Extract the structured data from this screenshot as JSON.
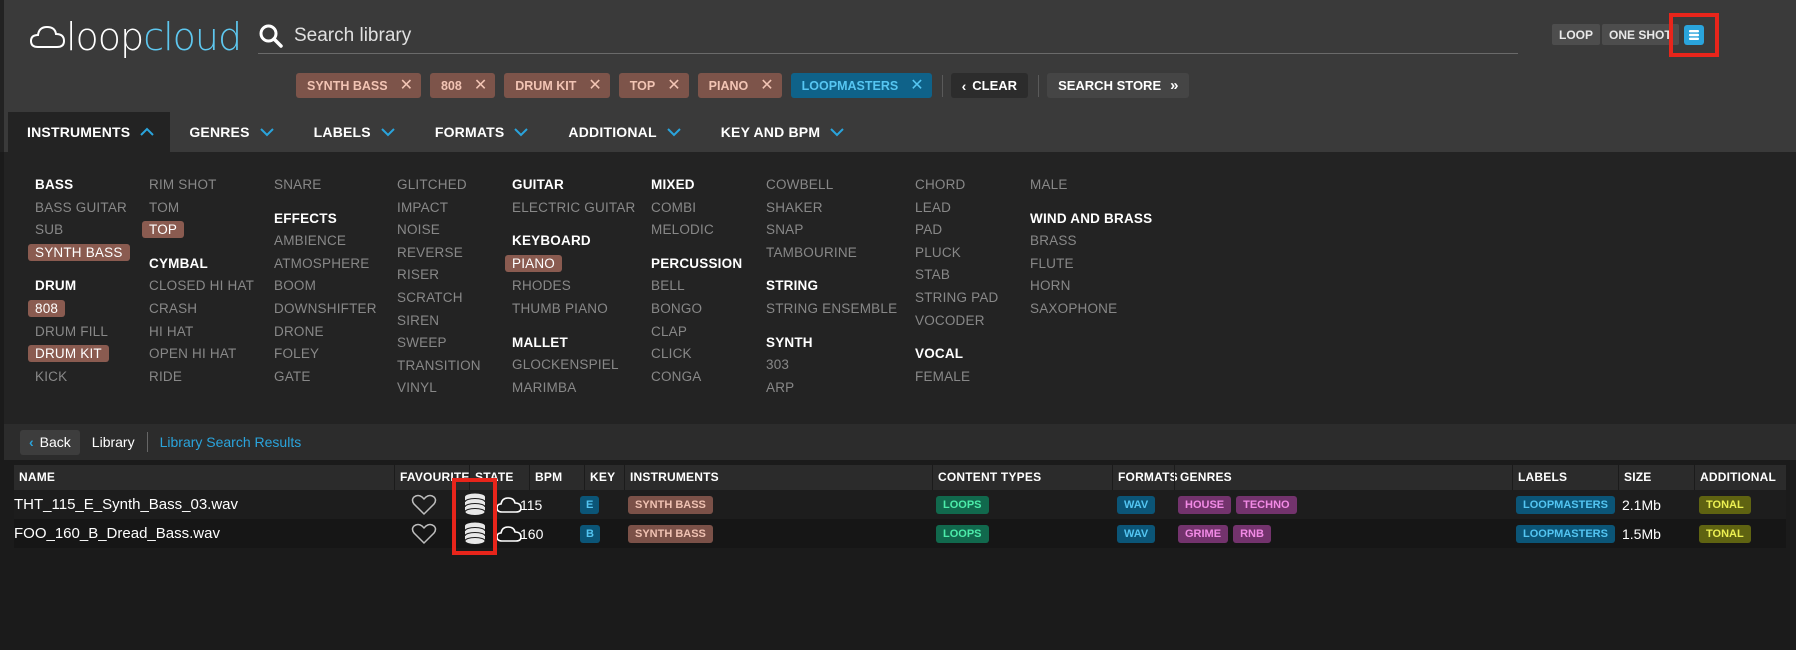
{
  "app": {
    "logo_part1": "loop",
    "logo_part2": "cloud"
  },
  "search": {
    "placeholder": "Search library"
  },
  "header_buttons": {
    "loop": "LOOP",
    "one_shot": "ONE SHOT"
  },
  "filters": {
    "chips": [
      {
        "label": "SYNTH BASS",
        "style": "brown"
      },
      {
        "label": "808",
        "style": "brown"
      },
      {
        "label": "DRUM KIT",
        "style": "brown"
      },
      {
        "label": "TOP",
        "style": "brown"
      },
      {
        "label": "PIANO",
        "style": "brown"
      },
      {
        "label": "LOOPMASTERS",
        "style": "blue"
      }
    ],
    "clear_label": "CLEAR",
    "search_store_label": "SEARCH STORE"
  },
  "tabs": [
    "INSTRUMENTS",
    "GENRES",
    "LABELS",
    "FORMATS",
    "ADDITIONAL",
    "KEY AND BPM"
  ],
  "instruments": {
    "columns": [
      [
        {
          "t": "BASS",
          "h": 1
        },
        {
          "t": "BASS GUITAR"
        },
        {
          "t": "SUB"
        },
        {
          "t": "SYNTH BASS",
          "s": 1
        },
        {
          "gap": 1
        },
        {
          "t": "DRUM",
          "h": 1
        },
        {
          "t": "808",
          "s": 1
        },
        {
          "t": "DRUM FILL"
        },
        {
          "t": "DRUM KIT",
          "s": 1
        },
        {
          "t": "KICK"
        }
      ],
      [
        {
          "t": "RIM SHOT"
        },
        {
          "t": "TOM"
        },
        {
          "t": "TOP",
          "s": 1
        },
        {
          "gap": 1
        },
        {
          "t": "CYMBAL",
          "h": 1
        },
        {
          "t": "CLOSED HI HAT"
        },
        {
          "t": "CRASH"
        },
        {
          "t": "HI HAT"
        },
        {
          "t": "OPEN HI HAT"
        },
        {
          "t": "RIDE"
        }
      ],
      [
        {
          "t": "SNARE"
        },
        {
          "gap": 1
        },
        {
          "t": "EFFECTS",
          "h": 1
        },
        {
          "t": "AMBIENCE"
        },
        {
          "t": "ATMOSPHERE"
        },
        {
          "t": "BOOM"
        },
        {
          "t": "DOWNSHIFTER"
        },
        {
          "t": "DRONE"
        },
        {
          "t": "FOLEY"
        },
        {
          "t": "GATE"
        }
      ],
      [
        {
          "t": "GLITCHED"
        },
        {
          "t": "IMPACT"
        },
        {
          "t": "NOISE"
        },
        {
          "t": "REVERSE"
        },
        {
          "t": "RISER"
        },
        {
          "t": "SCRATCH"
        },
        {
          "t": "SIREN"
        },
        {
          "t": "SWEEP"
        },
        {
          "t": "TRANSITION"
        },
        {
          "t": "VINYL"
        }
      ],
      [
        {
          "t": "GUITAR",
          "h": 1
        },
        {
          "t": "ELECTRIC GUITAR"
        },
        {
          "gap": 1
        },
        {
          "t": "KEYBOARD",
          "h": 1
        },
        {
          "t": "PIANO",
          "s": 1
        },
        {
          "t": "RHODES"
        },
        {
          "t": "THUMB PIANO"
        },
        {
          "gap": 1
        },
        {
          "t": "MALLET",
          "h": 1
        },
        {
          "t": "GLOCKENSPIEL"
        },
        {
          "t": "MARIMBA"
        }
      ],
      [
        {
          "t": "MIXED",
          "h": 1
        },
        {
          "t": "COMBI"
        },
        {
          "t": "MELODIC"
        },
        {
          "gap": 1
        },
        {
          "t": "PERCUSSION",
          "h": 1
        },
        {
          "t": "BELL"
        },
        {
          "t": "BONGO"
        },
        {
          "t": "CLAP"
        },
        {
          "t": "CLICK"
        },
        {
          "t": "CONGA"
        }
      ],
      [
        {
          "t": "COWBELL"
        },
        {
          "t": "SHAKER"
        },
        {
          "t": "SNAP"
        },
        {
          "t": "TAMBOURINE"
        },
        {
          "gap": 1
        },
        {
          "t": "STRING",
          "h": 1
        },
        {
          "t": "STRING ENSEMBLE"
        },
        {
          "gap": 1
        },
        {
          "t": "SYNTH",
          "h": 1
        },
        {
          "t": "303"
        },
        {
          "t": "ARP"
        }
      ],
      [
        {
          "t": "CHORD"
        },
        {
          "t": "LEAD"
        },
        {
          "t": "PAD"
        },
        {
          "t": "PLUCK"
        },
        {
          "t": "STAB"
        },
        {
          "t": "STRING PAD"
        },
        {
          "t": "VOCODER"
        },
        {
          "gap": 1
        },
        {
          "t": "VOCAL",
          "h": 1
        },
        {
          "t": "FEMALE"
        }
      ],
      [
        {
          "t": "MALE"
        },
        {
          "gap": 1
        },
        {
          "t": "WIND AND BRASS",
          "h": 1
        },
        {
          "t": "BRASS"
        },
        {
          "t": "FLUTE"
        },
        {
          "t": "HORN"
        },
        {
          "t": "SAXOPHONE"
        }
      ]
    ]
  },
  "breadcrumb": {
    "back": "Back",
    "library": "Library",
    "current": "Library Search Results"
  },
  "table": {
    "headers": [
      "NAME",
      "FAVOURITE",
      "STATE",
      "BPM",
      "KEY",
      "INSTRUMENTS",
      "CONTENT TYPES",
      "FORMATS",
      "GENRES",
      "LABELS",
      "SIZE",
      "ADDITIONAL"
    ],
    "rows": [
      {
        "name": "THT_115_E_Synth_Bass_03.wav",
        "bpm": "115",
        "key": "E",
        "instruments": [
          "SYNTH BASS"
        ],
        "content_types": [
          "LOOPS"
        ],
        "formats": [
          "WAV"
        ],
        "genres": [
          "HOUSE",
          "TECHNO"
        ],
        "labels": [
          "LOOPMASTERS"
        ],
        "size": "2.1Mb",
        "additional": [
          "TONAL"
        ]
      },
      {
        "name": "FOO_160_B_Dread_Bass.wav",
        "bpm": "160",
        "key": "B",
        "instruments": [
          "SYNTH BASS"
        ],
        "content_types": [
          "LOOPS"
        ],
        "formats": [
          "WAV"
        ],
        "genres": [
          "GRIME",
          "RNB"
        ],
        "labels": [
          "LOOPMASTERS"
        ],
        "size": "1.5Mb",
        "additional": [
          "TONAL"
        ]
      }
    ]
  },
  "colors": {
    "accent_blue": "#2aa4dc",
    "highlight_red": "#e8251b",
    "chip_brown": "#7d544a"
  }
}
